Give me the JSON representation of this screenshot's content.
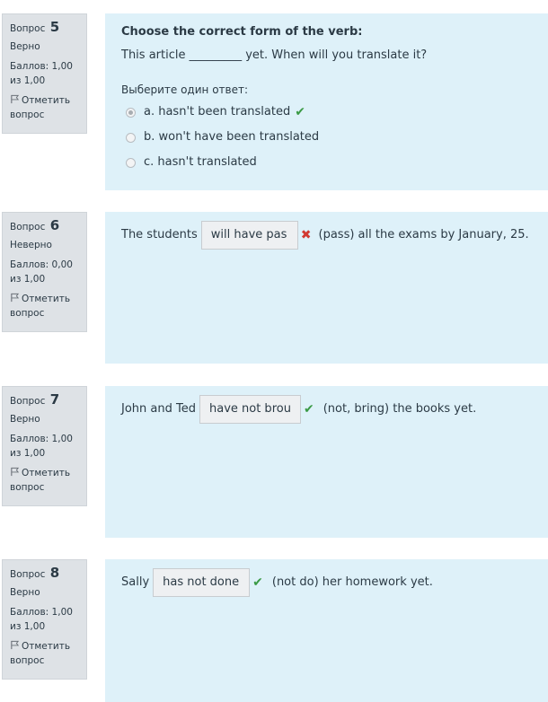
{
  "q5": {
    "label": "Вопрос",
    "number": "5",
    "state": "Верно",
    "grade": "Баллов: 1,00 из 1,00",
    "flag": "Отметить вопрос",
    "title": "Choose the correct form of the verb:",
    "sentence": "This article _________ yet. When will you translate it?",
    "prompt": "Выберите один ответ:",
    "options": [
      {
        "label": "a. hasn't been translated"
      },
      {
        "label": "b. won't have been translated"
      },
      {
        "label": "c. hasn't translated"
      }
    ]
  },
  "q6": {
    "label": "Вопрос",
    "number": "6",
    "state": "Неверно",
    "grade": "Баллов: 0,00 из 1,00",
    "flag": "Отметить вопрос",
    "before": "The students",
    "answer": "will have pas",
    "after": "(pass) all the exams by January, 25."
  },
  "q7": {
    "label": "Вопрос",
    "number": "7",
    "state": "Верно",
    "grade": "Баллов: 1,00 из 1,00",
    "flag": "Отметить вопрос",
    "before": "John and Ted",
    "answer": "have not brou",
    "after": "(not, bring) the books yet."
  },
  "q8": {
    "label": "Вопрос",
    "number": "8",
    "state": "Верно",
    "grade": "Баллов: 1,00 из 1,00",
    "flag": "Отметить вопрос",
    "before": "Sally",
    "answer": "has not done",
    "after": "(not do) her homework yet."
  },
  "icons": {
    "correct": "check-icon",
    "incorrect": "cross-icon",
    "flag": "flag-icon",
    "correct_color": "#3a9a45",
    "incorrect_color": "#d13a32",
    "content_bg": "#def1f9",
    "info_bg": "#dee2e6"
  }
}
